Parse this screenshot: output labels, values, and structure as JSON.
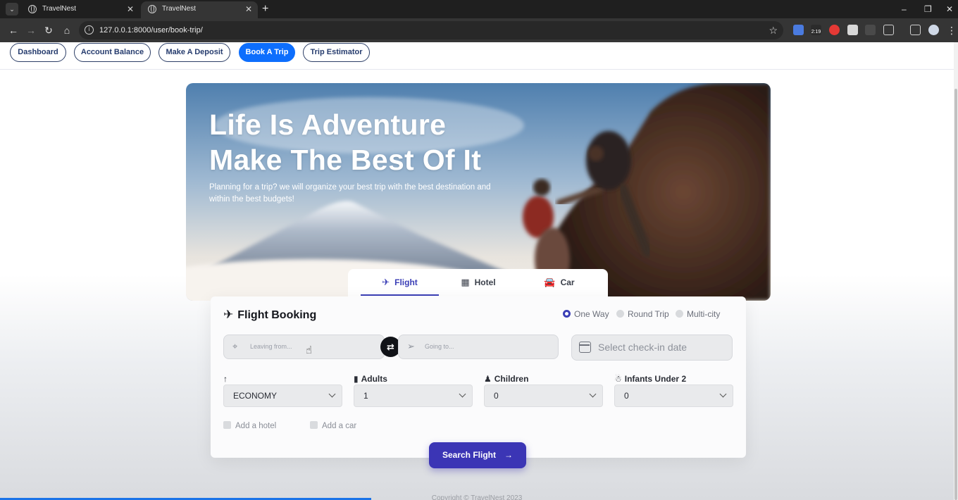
{
  "browser": {
    "tabs": [
      {
        "title": "TravelNest"
      },
      {
        "title": "TravelNest"
      }
    ],
    "new_tab": "+",
    "url": "127.0.0.1:8000/user/book-trip/",
    "window_controls": [
      "–",
      "❐",
      "✕"
    ],
    "ext_badge": "2:19"
  },
  "nav": {
    "items": [
      {
        "label": "Dashboard",
        "active": false
      },
      {
        "label": "Account Balance",
        "active": false
      },
      {
        "label": "Make A Deposit",
        "active": false
      },
      {
        "label": "Book A Trip",
        "active": true
      },
      {
        "label": "Trip Estimator",
        "active": false
      }
    ]
  },
  "hero": {
    "title_line1": "Life Is Adventure",
    "title_line2": "Make The Best Of It",
    "subtitle": "Planning for a trip? we will organize your best trip with the best destination and within the best budgets!"
  },
  "modes": [
    {
      "label": "Flight",
      "icon": "plane-icon",
      "active": true
    },
    {
      "label": "Hotel",
      "icon": "building-icon",
      "active": false
    },
    {
      "label": "Car",
      "icon": "car-icon",
      "active": false
    }
  ],
  "booking": {
    "title": "Flight Booking",
    "trip_types": [
      {
        "label": "One Way",
        "selected": true
      },
      {
        "label": "Round Trip",
        "selected": false
      },
      {
        "label": "Multi-city",
        "selected": false
      }
    ],
    "from_placeholder": "Leaving from...",
    "to_placeholder": "Going to...",
    "date_placeholder": "Select check-in date",
    "class_label": "",
    "class_value": "ECONOMY",
    "adults_label": "Adults",
    "adults_value": "1",
    "children_label": "Children",
    "children_value": "0",
    "infants_label": "Infants Under 2",
    "infants_value": "0",
    "add_hotel": "Add a hotel",
    "add_car": "Add a car",
    "search_label": "Search Flight"
  },
  "footer": {
    "text": "Copyright © TravelNest 2023"
  },
  "colors": {
    "accent": "#3b35b5",
    "nav_active": "#0d6efd",
    "nav_text": "#263c6e"
  }
}
